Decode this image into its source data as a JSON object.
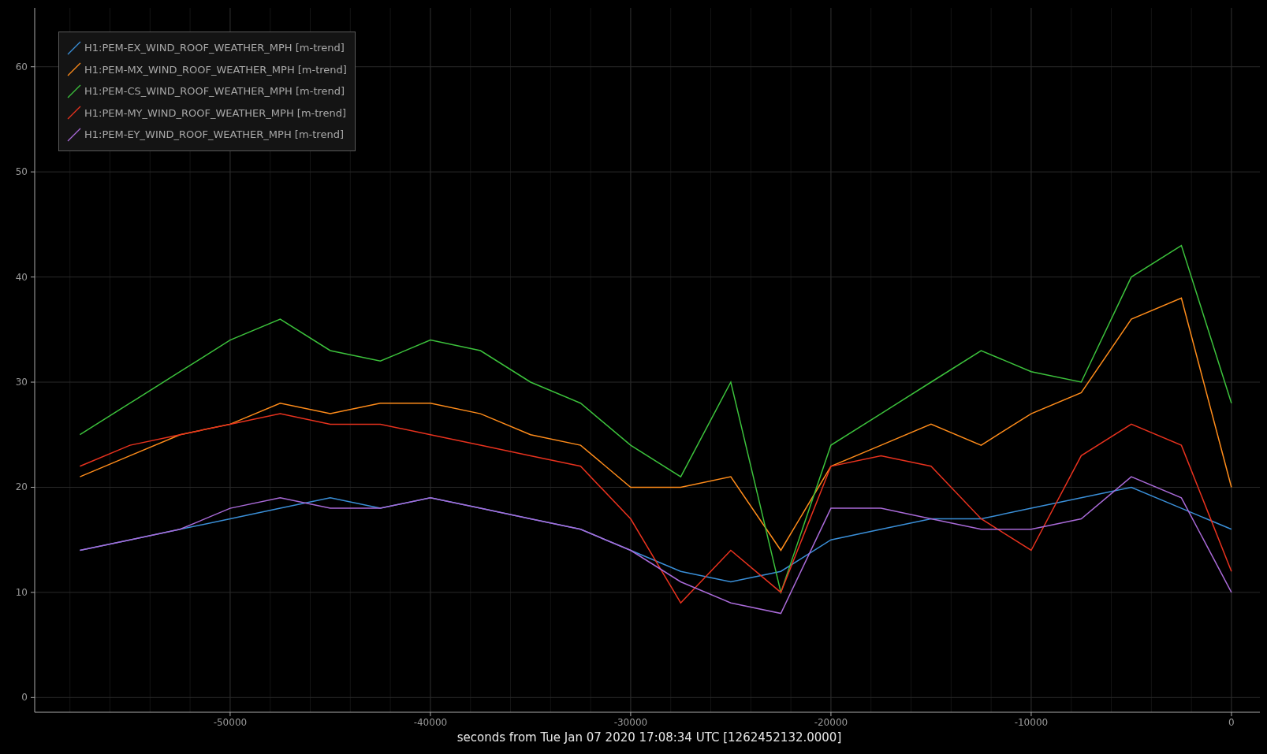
{
  "plot": {
    "chart_data": {
      "type": "line",
      "grid": true,
      "legend": true,
      "xlabel": "seconds from Tue Jan 07 2020 17:08:34 UTC [1262452132.0000]",
      "xlim": [
        -59760,
        1420
      ],
      "ylim": [
        -1.4,
        65.6
      ],
      "xticks": [
        {
          "value": -50000,
          "label": "-50000"
        },
        {
          "value": -40000,
          "label": "-40000"
        },
        {
          "value": -30000,
          "label": "-30000"
        },
        {
          "value": -20000,
          "label": "-20000"
        },
        {
          "value": -10000,
          "label": "-10000"
        },
        {
          "value": 0,
          "label": "0"
        }
      ],
      "yticks": [
        {
          "value": 0,
          "label": "0"
        },
        {
          "value": 10,
          "label": "10"
        },
        {
          "value": 20,
          "label": "20"
        },
        {
          "value": 30,
          "label": "30"
        },
        {
          "value": 40,
          "label": "40"
        },
        {
          "value": 50,
          "label": "50"
        },
        {
          "value": 60,
          "label": "60"
        }
      ],
      "x": [
        -57500,
        -55000,
        -52500,
        -50000,
        -47500,
        -45000,
        -42500,
        -40000,
        -37500,
        -35000,
        -32500,
        -30000,
        -27500,
        -25000,
        -22500,
        -20000,
        -17500,
        -15000,
        -12500,
        -10000,
        -7500,
        -5000,
        -2500,
        0
      ],
      "series": [
        {
          "name": "H1:PEM-EX_WIND_ROOF_WEATHER_MPH [m-trend]",
          "color": "#3a8fd8",
          "values": [
            14,
            15,
            16,
            17,
            18,
            19,
            18,
            19,
            18,
            17,
            16,
            14,
            12,
            11,
            12,
            15,
            16,
            17,
            17,
            18,
            19,
            20,
            18,
            16
          ]
        },
        {
          "name": "H1:PEM-MX_WIND_ROOF_WEATHER_MPH [m-trend]",
          "color": "#ff8c1a",
          "values": [
            21,
            23,
            25,
            26,
            28,
            27,
            28,
            28,
            27,
            25,
            24,
            20,
            20,
            21,
            14,
            22,
            24,
            26,
            24,
            27,
            29,
            36,
            38,
            20
          ]
        },
        {
          "name": "H1:PEM-CS_WIND_ROOF_WEATHER_MPH [m-trend]",
          "color": "#3cc23c",
          "values": [
            25,
            28,
            31,
            34,
            36,
            33,
            32,
            34,
            33,
            30,
            28,
            24,
            21,
            30,
            10,
            24,
            27,
            30,
            33,
            31,
            30,
            40,
            43,
            28
          ]
        },
        {
          "name": "H1:PEM-MY_WIND_ROOF_WEATHER_MPH [m-trend]",
          "color": "#e8321e",
          "values": [
            22,
            24,
            25,
            26,
            27,
            26,
            26,
            25,
            24,
            23,
            22,
            17,
            9,
            14,
            10,
            22,
            23,
            22,
            17,
            14,
            23,
            26,
            24,
            12
          ]
        },
        {
          "name": "H1:PEM-EY_WIND_ROOF_WEATHER_MPH [m-trend]",
          "color": "#a96ad8",
          "values": [
            14,
            15,
            16,
            18,
            19,
            18,
            18,
            19,
            18,
            17,
            16,
            14,
            11,
            9,
            8,
            18,
            18,
            17,
            16,
            16,
            17,
            21,
            19,
            10
          ]
        }
      ]
    }
  }
}
